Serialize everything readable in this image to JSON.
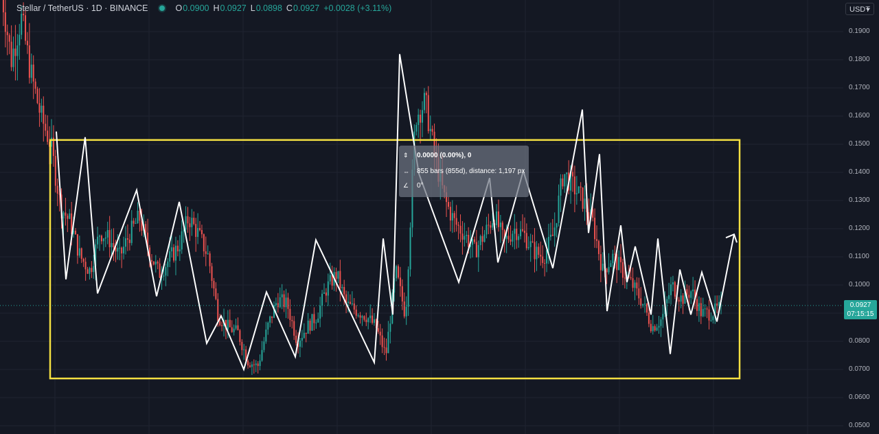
{
  "header": {
    "symbol": "Stellar / TetherUS · 1D · BINANCE",
    "ohlc": [
      {
        "key": "O",
        "value": "0.0900"
      },
      {
        "key": "H",
        "value": "0.0927"
      },
      {
        "key": "L",
        "value": "0.0898"
      },
      {
        "key": "C",
        "value": "0.0927"
      }
    ],
    "change": "+0.0028 (+3.11%)"
  },
  "currency_button": "USDT",
  "price_axis": {
    "ticks": [
      "0.1900",
      "0.1800",
      "0.1700",
      "0.1600",
      "0.1500",
      "0.1400",
      "0.1300",
      "0.1200",
      "0.1100",
      "0.1000",
      "0.0900",
      "0.0800",
      "0.0700",
      "0.0600",
      "0.0500"
    ]
  },
  "price_label": {
    "price": "0.0927",
    "countdown": "07:15:15"
  },
  "measure_tooltip": {
    "line1": "0.0000 (0.00%), 0",
    "line2": "855 bars (855d), distance: 1,197 px",
    "line3": "0°"
  },
  "colors": {
    "up": "#26a69a",
    "down": "#ef5350",
    "box": "#f5e042",
    "zigzag": "#ffffff",
    "background": "#141823"
  },
  "chart_data": {
    "type": "candlestick",
    "ylim": [
      0.048,
      0.197
    ],
    "current_price": 0.0927,
    "range_box": {
      "top": 0.1515,
      "bottom": 0.0668
    },
    "zigzag": [
      0.1545,
      0.102,
      0.1525,
      0.097,
      0.1337,
      0.096,
      0.1295,
      0.0793,
      0.089,
      0.07,
      0.0975,
      0.0745,
      0.116,
      0.0725,
      0.1165,
      0.0895,
      0.182,
      0.1395,
      0.101,
      0.138,
      0.108,
      0.1405,
      0.106,
      0.1623,
      0.1185,
      0.1465,
      0.0907,
      0.1212,
      0.101,
      0.1137,
      0.0895,
      0.1165,
      0.0755,
      0.1055,
      0.0895,
      0.1045,
      0.087,
      0.118
    ],
    "candles_profile": [
      0.205,
      0.18,
      0.195,
      0.175,
      0.16,
      0.15,
      0.128,
      0.122,
      0.11,
      0.105,
      0.119,
      0.116,
      0.11,
      0.118,
      0.124,
      0.112,
      0.104,
      0.109,
      0.114,
      0.124,
      0.118,
      0.11,
      0.089,
      0.085,
      0.083,
      0.073,
      0.071,
      0.085,
      0.095,
      0.093,
      0.08,
      0.085,
      0.089,
      0.099,
      0.104,
      0.093,
      0.091,
      0.089,
      0.085,
      0.075,
      0.105,
      0.089,
      0.16,
      0.165,
      0.145,
      0.13,
      0.122,
      0.118,
      0.112,
      0.118,
      0.125,
      0.115,
      0.12,
      0.118,
      0.112,
      0.11,
      0.118,
      0.14,
      0.135,
      0.13,
      0.122,
      0.105,
      0.11,
      0.105,
      0.1,
      0.094,
      0.085,
      0.088,
      0.1,
      0.095,
      0.098,
      0.09,
      0.09,
      0.092
    ]
  }
}
